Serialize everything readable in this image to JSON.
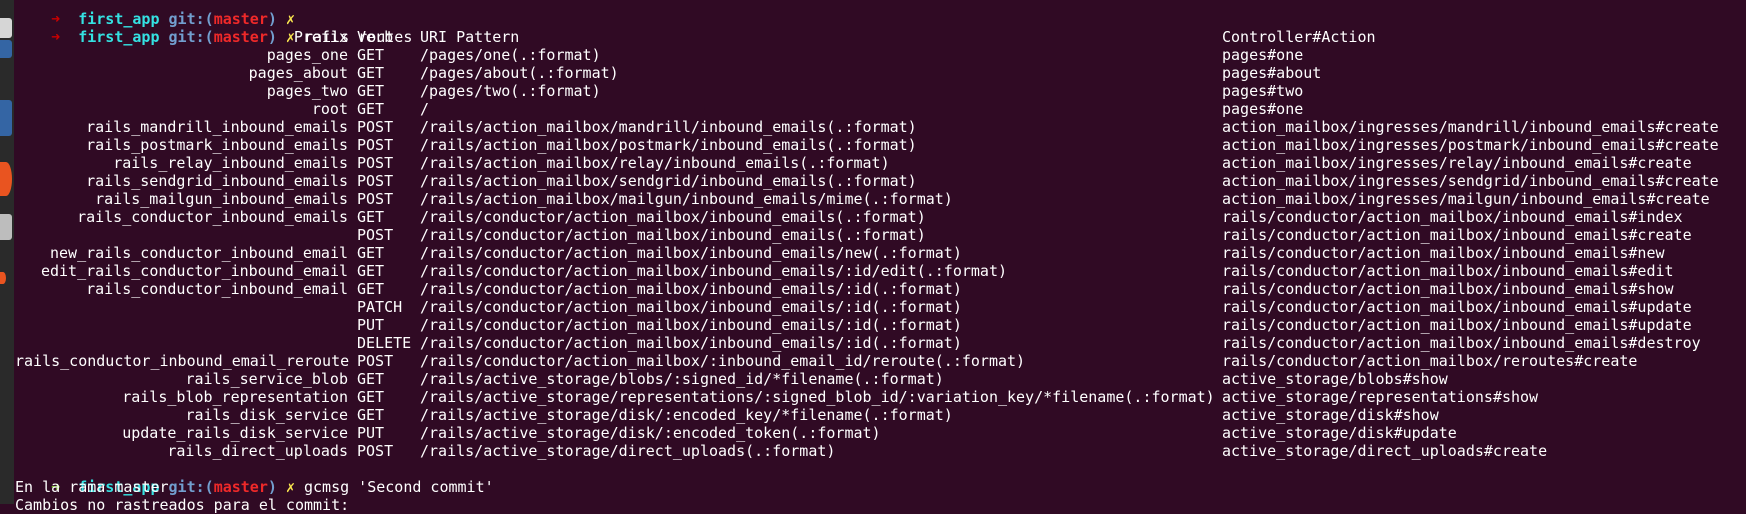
{
  "colors": {
    "background": "#300a24",
    "error_arrow": "#cc0000",
    "ok_arrow": "#8ae234",
    "directory": "#34e2e2",
    "git_label": "#729fcf",
    "branch": "#ef2929",
    "dirty_mark": "#fce94f"
  },
  "dock": {
    "icons": [
      "app-icon",
      "app-icon",
      "app-icon",
      "app-icon",
      "app-icon",
      "app-icon"
    ]
  },
  "terminal": {
    "prompts": [
      {
        "arrow": "➜",
        "dir": "first_app",
        "git": "git:(",
        "branch": "master",
        "git_close": ")",
        "dirty": "✗",
        "command": ""
      },
      {
        "arrow": "➜",
        "dir": "first_app",
        "git": "git:(",
        "branch": "master",
        "git_close": ")",
        "dirty": "✗",
        "command": "rails routes"
      }
    ],
    "routes_header": {
      "prefix": "Prefix",
      "verb": "Verb",
      "uri": "URI Pattern",
      "controller": "Controller#Action"
    },
    "routes": [
      {
        "prefix": "pages_one",
        "verb": "GET",
        "uri": "/pages/one(.:format)",
        "controller": "pages#one"
      },
      {
        "prefix": "pages_about",
        "verb": "GET",
        "uri": "/pages/about(.:format)",
        "controller": "pages#about"
      },
      {
        "prefix": "pages_two",
        "verb": "GET",
        "uri": "/pages/two(.:format)",
        "controller": "pages#two"
      },
      {
        "prefix": "root",
        "verb": "GET",
        "uri": "/",
        "controller": "pages#one"
      },
      {
        "prefix": "rails_mandrill_inbound_emails",
        "verb": "POST",
        "uri": "/rails/action_mailbox/mandrill/inbound_emails(.:format)",
        "controller": "action_mailbox/ingresses/mandrill/inbound_emails#create"
      },
      {
        "prefix": "rails_postmark_inbound_emails",
        "verb": "POST",
        "uri": "/rails/action_mailbox/postmark/inbound_emails(.:format)",
        "controller": "action_mailbox/ingresses/postmark/inbound_emails#create"
      },
      {
        "prefix": "rails_relay_inbound_emails",
        "verb": "POST",
        "uri": "/rails/action_mailbox/relay/inbound_emails(.:format)",
        "controller": "action_mailbox/ingresses/relay/inbound_emails#create"
      },
      {
        "prefix": "rails_sendgrid_inbound_emails",
        "verb": "POST",
        "uri": "/rails/action_mailbox/sendgrid/inbound_emails(.:format)",
        "controller": "action_mailbox/ingresses/sendgrid/inbound_emails#create"
      },
      {
        "prefix": "rails_mailgun_inbound_emails",
        "verb": "POST",
        "uri": "/rails/action_mailbox/mailgun/inbound_emails/mime(.:format)",
        "controller": "action_mailbox/ingresses/mailgun/inbound_emails#create"
      },
      {
        "prefix": "rails_conductor_inbound_emails",
        "verb": "GET",
        "uri": "/rails/conductor/action_mailbox/inbound_emails(.:format)",
        "controller": "rails/conductor/action_mailbox/inbound_emails#index"
      },
      {
        "prefix": "",
        "verb": "POST",
        "uri": "/rails/conductor/action_mailbox/inbound_emails(.:format)",
        "controller": "rails/conductor/action_mailbox/inbound_emails#create"
      },
      {
        "prefix": "new_rails_conductor_inbound_email",
        "verb": "GET",
        "uri": "/rails/conductor/action_mailbox/inbound_emails/new(.:format)",
        "controller": "rails/conductor/action_mailbox/inbound_emails#new"
      },
      {
        "prefix": "edit_rails_conductor_inbound_email",
        "verb": "GET",
        "uri": "/rails/conductor/action_mailbox/inbound_emails/:id/edit(.:format)",
        "controller": "rails/conductor/action_mailbox/inbound_emails#edit"
      },
      {
        "prefix": "rails_conductor_inbound_email",
        "verb": "GET",
        "uri": "/rails/conductor/action_mailbox/inbound_emails/:id(.:format)",
        "controller": "rails/conductor/action_mailbox/inbound_emails#show"
      },
      {
        "prefix": "",
        "verb": "PATCH",
        "uri": "/rails/conductor/action_mailbox/inbound_emails/:id(.:format)",
        "controller": "rails/conductor/action_mailbox/inbound_emails#update"
      },
      {
        "prefix": "",
        "verb": "PUT",
        "uri": "/rails/conductor/action_mailbox/inbound_emails/:id(.:format)",
        "controller": "rails/conductor/action_mailbox/inbound_emails#update"
      },
      {
        "prefix": "",
        "verb": "DELETE",
        "uri": "/rails/conductor/action_mailbox/inbound_emails/:id(.:format)",
        "controller": "rails/conductor/action_mailbox/inbound_emails#destroy"
      },
      {
        "prefix": "rails_conductor_inbound_email_reroute",
        "verb": "POST",
        "uri": "/rails/conductor/action_mailbox/:inbound_email_id/reroute(.:format)",
        "controller": "rails/conductor/action_mailbox/reroutes#create"
      },
      {
        "prefix": "rails_service_blob",
        "verb": "GET",
        "uri": "/rails/active_storage/blobs/:signed_id/*filename(.:format)",
        "controller": "active_storage/blobs#show"
      },
      {
        "prefix": "rails_blob_representation",
        "verb": "GET",
        "uri": "/rails/active_storage/representations/:signed_blob_id/:variation_key/*filename(.:format)",
        "controller": "active_storage/representations#show"
      },
      {
        "prefix": "rails_disk_service",
        "verb": "GET",
        "uri": "/rails/active_storage/disk/:encoded_key/*filename(.:format)",
        "controller": "active_storage/disk#show"
      },
      {
        "prefix": "update_rails_disk_service",
        "verb": "PUT",
        "uri": "/rails/active_storage/disk/:encoded_token(.:format)",
        "controller": "active_storage/disk#update"
      },
      {
        "prefix": "rails_direct_uploads",
        "verb": "POST",
        "uri": "/rails/active_storage/direct_uploads(.:format)",
        "controller": "active_storage/direct_uploads#create"
      }
    ],
    "final_prompt": {
      "arrow": "➜",
      "dir": "first_app",
      "git": "git:(",
      "branch": "master",
      "git_close": ")",
      "dirty": "✗",
      "command": "gcmsg 'Second commit'"
    },
    "output": [
      "En la rama master",
      "Cambios no rastreados para el commit:"
    ]
  }
}
